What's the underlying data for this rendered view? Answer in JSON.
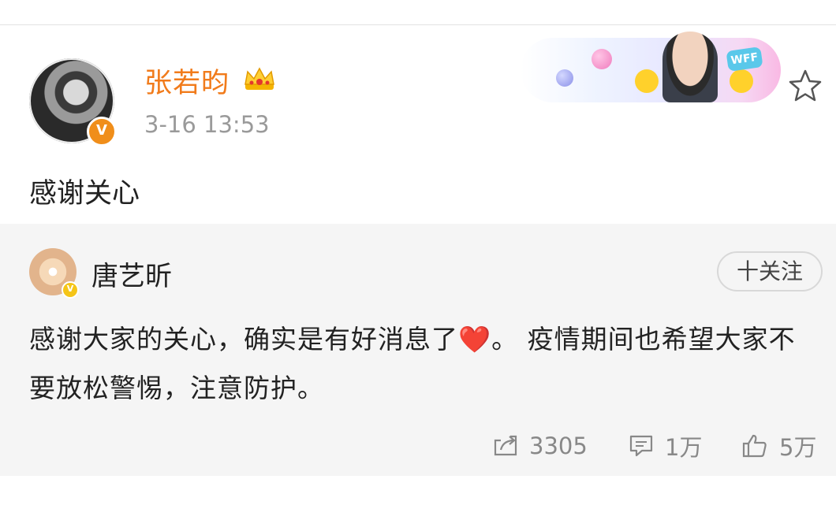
{
  "post": {
    "username": "张若昀",
    "time": "3-16 13:53",
    "text": "感谢关心",
    "verified_badge": "V"
  },
  "repost": {
    "username": "唐艺昕",
    "verified_badge": "V",
    "follow_label": "十关注",
    "text_before_emoji": "感谢大家的关心，确实是有好消息了",
    "emoji": "❤️",
    "text_after_emoji": "。 疫情期间也希望大家不要放松警惕，注意防护。",
    "actions": {
      "share_count": "3305",
      "comment_count": "1万",
      "like_count": "5万"
    }
  },
  "banner": {
    "badge_text": "WFF"
  },
  "colors": {
    "username_accent": "#f17b1b",
    "verified": "#f08e1a",
    "repost_bg": "#f5f5f5",
    "heart": "#e0302a"
  },
  "icons": [
    "crown-icon",
    "star-icon",
    "share-icon",
    "comment-icon",
    "like-icon",
    "verified-icon"
  ]
}
